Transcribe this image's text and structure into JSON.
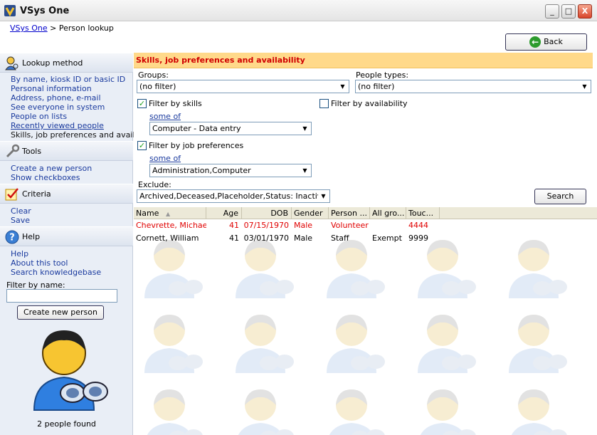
{
  "window": {
    "title": "VSys One",
    "app_icon": "vsys-logo-icon",
    "min": "_",
    "max": "□",
    "close": "X"
  },
  "breadcrumb": {
    "root": "VSys One",
    "sep": ">",
    "current": "Person lookup"
  },
  "back_button": {
    "label": "Back",
    "icon": "back-arrow-icon"
  },
  "sidebar": {
    "lookup_method": {
      "title": "Lookup method",
      "icon": "person-search-icon",
      "items": [
        "By name, kiosk ID or basic ID",
        "Personal information",
        "Address, phone, e-mail",
        "See everyone in system",
        "People on lists",
        "Recently viewed people",
        "Skills, job preferences and availa..."
      ]
    },
    "tools": {
      "title": "Tools",
      "icon": "wrench-icon",
      "items": [
        "Create a new person",
        "Show checkboxes"
      ]
    },
    "criteria": {
      "title": "Criteria",
      "icon": "checklist-icon",
      "items": [
        "Clear",
        "Save"
      ]
    },
    "help": {
      "title": "Help",
      "icon": "help-icon",
      "items": [
        "Help",
        "About this tool",
        "Search knowledgebase"
      ]
    },
    "filter_label": "Filter by name:",
    "filter_value": "",
    "create_button": "Create new person",
    "count_text": "2 people found"
  },
  "main": {
    "section_title": "Skills, job preferences and availability",
    "groups_label": "Groups:",
    "groups_value": "(no filter)",
    "people_types_label": "People types:",
    "people_types_value": "(no filter)",
    "filter_skills_label": "Filter by skills",
    "filter_skills_checked": true,
    "skills_match": "some of",
    "skills_value": "Computer - Data entry",
    "filter_availability_label": "Filter by availability",
    "filter_availability_checked": false,
    "filter_jobpref_label": "Filter by job preferences",
    "filter_jobpref_checked": true,
    "jobpref_match": "some of",
    "jobpref_value": "Administration,Computer",
    "exclude_label": "Exclude:",
    "exclude_value": "Archived,Deceased,Placeholder,Status: Inactive,Sta",
    "search_button": "Search",
    "check_mark": "✓"
  },
  "table": {
    "columns": [
      "Name",
      "Age",
      "DOB",
      "Gender",
      "Person ...",
      "All gro...",
      "Touc..."
    ],
    "sort_indicator": "▲",
    "rows": [
      {
        "name": "Chevrette, Michael",
        "age": "41",
        "dob": "07/15/1970",
        "gender": "Male",
        "person_type": "Volunteer",
        "all_groups": "",
        "touch": "4444",
        "highlight": true
      },
      {
        "name": "Cornett, William",
        "age": "41",
        "dob": "03/01/1970",
        "gender": "Male",
        "person_type": "Staff",
        "all_groups": "Exempt",
        "touch": "9999",
        "highlight": false
      }
    ]
  },
  "colors": {
    "section_bg": "#ffd98a",
    "section_text": "#d00000",
    "highlight_row": "#e00000",
    "link": "#1a3a9e"
  }
}
